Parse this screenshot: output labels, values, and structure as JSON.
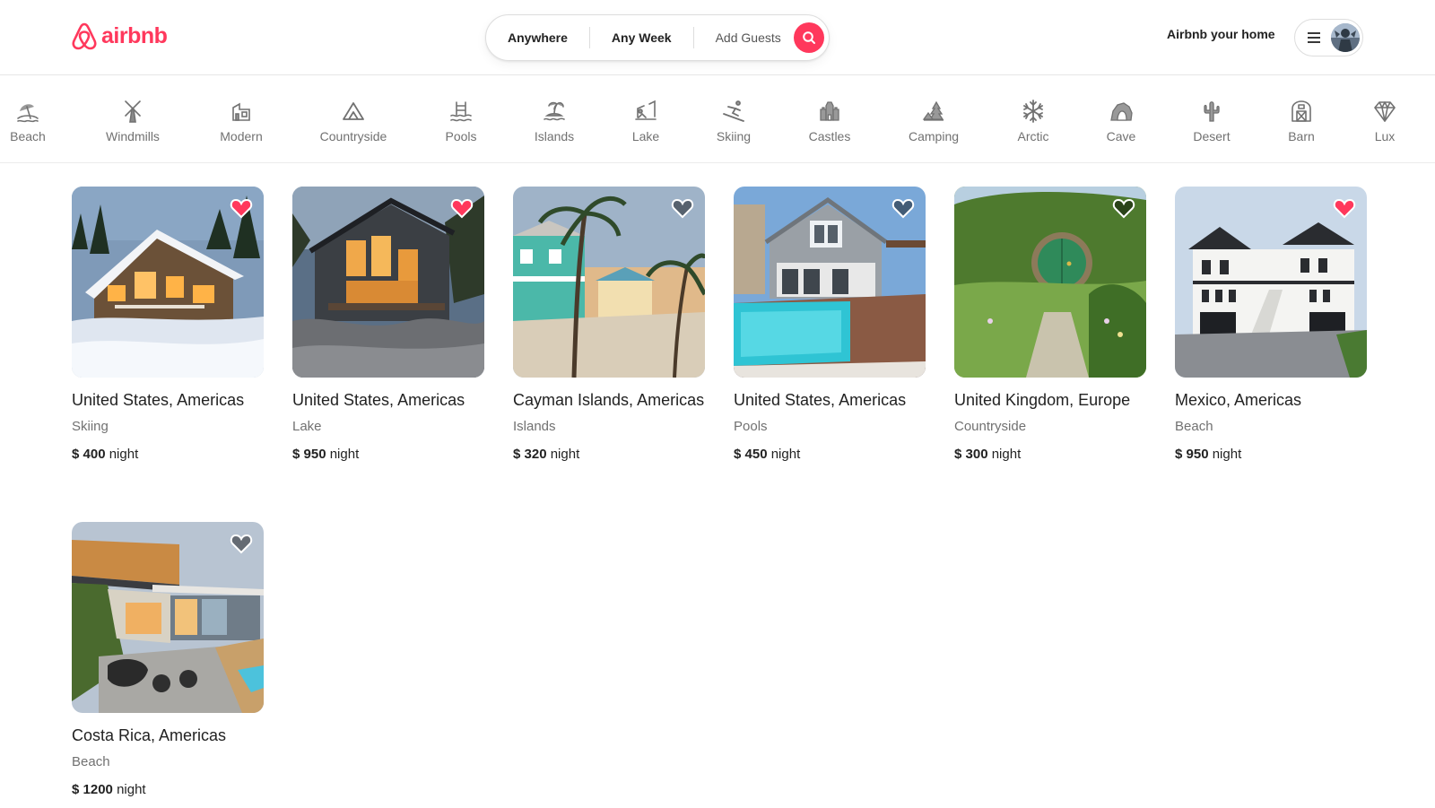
{
  "brand": {
    "name": "airbnb",
    "color": "#ff385c"
  },
  "search": {
    "where": "Anywhere",
    "when": "Any Week",
    "guests": "Add Guests",
    "icon": "search-icon"
  },
  "header": {
    "host_link": "Airbnb your home",
    "menu_icon": "hamburger-icon",
    "avatar": "user-avatar"
  },
  "categories": [
    {
      "label": "Beach",
      "icon": "beach-icon"
    },
    {
      "label": "Windmills",
      "icon": "windmill-icon"
    },
    {
      "label": "Modern",
      "icon": "modern-house-icon"
    },
    {
      "label": "Countryside",
      "icon": "mountain-icon"
    },
    {
      "label": "Pools",
      "icon": "pool-icon"
    },
    {
      "label": "Islands",
      "icon": "island-icon"
    },
    {
      "label": "Lake",
      "icon": "lake-icon"
    },
    {
      "label": "Skiing",
      "icon": "skiing-icon"
    },
    {
      "label": "Castles",
      "icon": "castle-icon"
    },
    {
      "label": "Camping",
      "icon": "camping-icon"
    },
    {
      "label": "Arctic",
      "icon": "snowflake-icon"
    },
    {
      "label": "Cave",
      "icon": "cave-icon"
    },
    {
      "label": "Desert",
      "icon": "cactus-icon"
    },
    {
      "label": "Barn",
      "icon": "barn-icon"
    },
    {
      "label": "Lux",
      "icon": "diamond-icon"
    }
  ],
  "listings": [
    {
      "location": "United States, Americas",
      "category": "Skiing",
      "price": "$ 400",
      "unit": "night",
      "favorite": true
    },
    {
      "location": "United States, Americas",
      "category": "Lake",
      "price": "$ 950",
      "unit": "night",
      "favorite": true
    },
    {
      "location": "Cayman Islands, Americas",
      "category": "Islands",
      "price": "$ 320",
      "unit": "night",
      "favorite": false
    },
    {
      "location": "United States, Americas",
      "category": "Pools",
      "price": "$ 450",
      "unit": "night",
      "favorite": false
    },
    {
      "location": "United Kingdom, Europe",
      "category": "Countryside",
      "price": "$ 300",
      "unit": "night",
      "favorite": false
    },
    {
      "location": "Mexico, Americas",
      "category": "Beach",
      "price": "$ 950",
      "unit": "night",
      "favorite": true
    },
    {
      "location": "Costa Rica, Americas",
      "category": "Beach",
      "price": "$ 1200",
      "unit": "night",
      "favorite": false
    }
  ]
}
